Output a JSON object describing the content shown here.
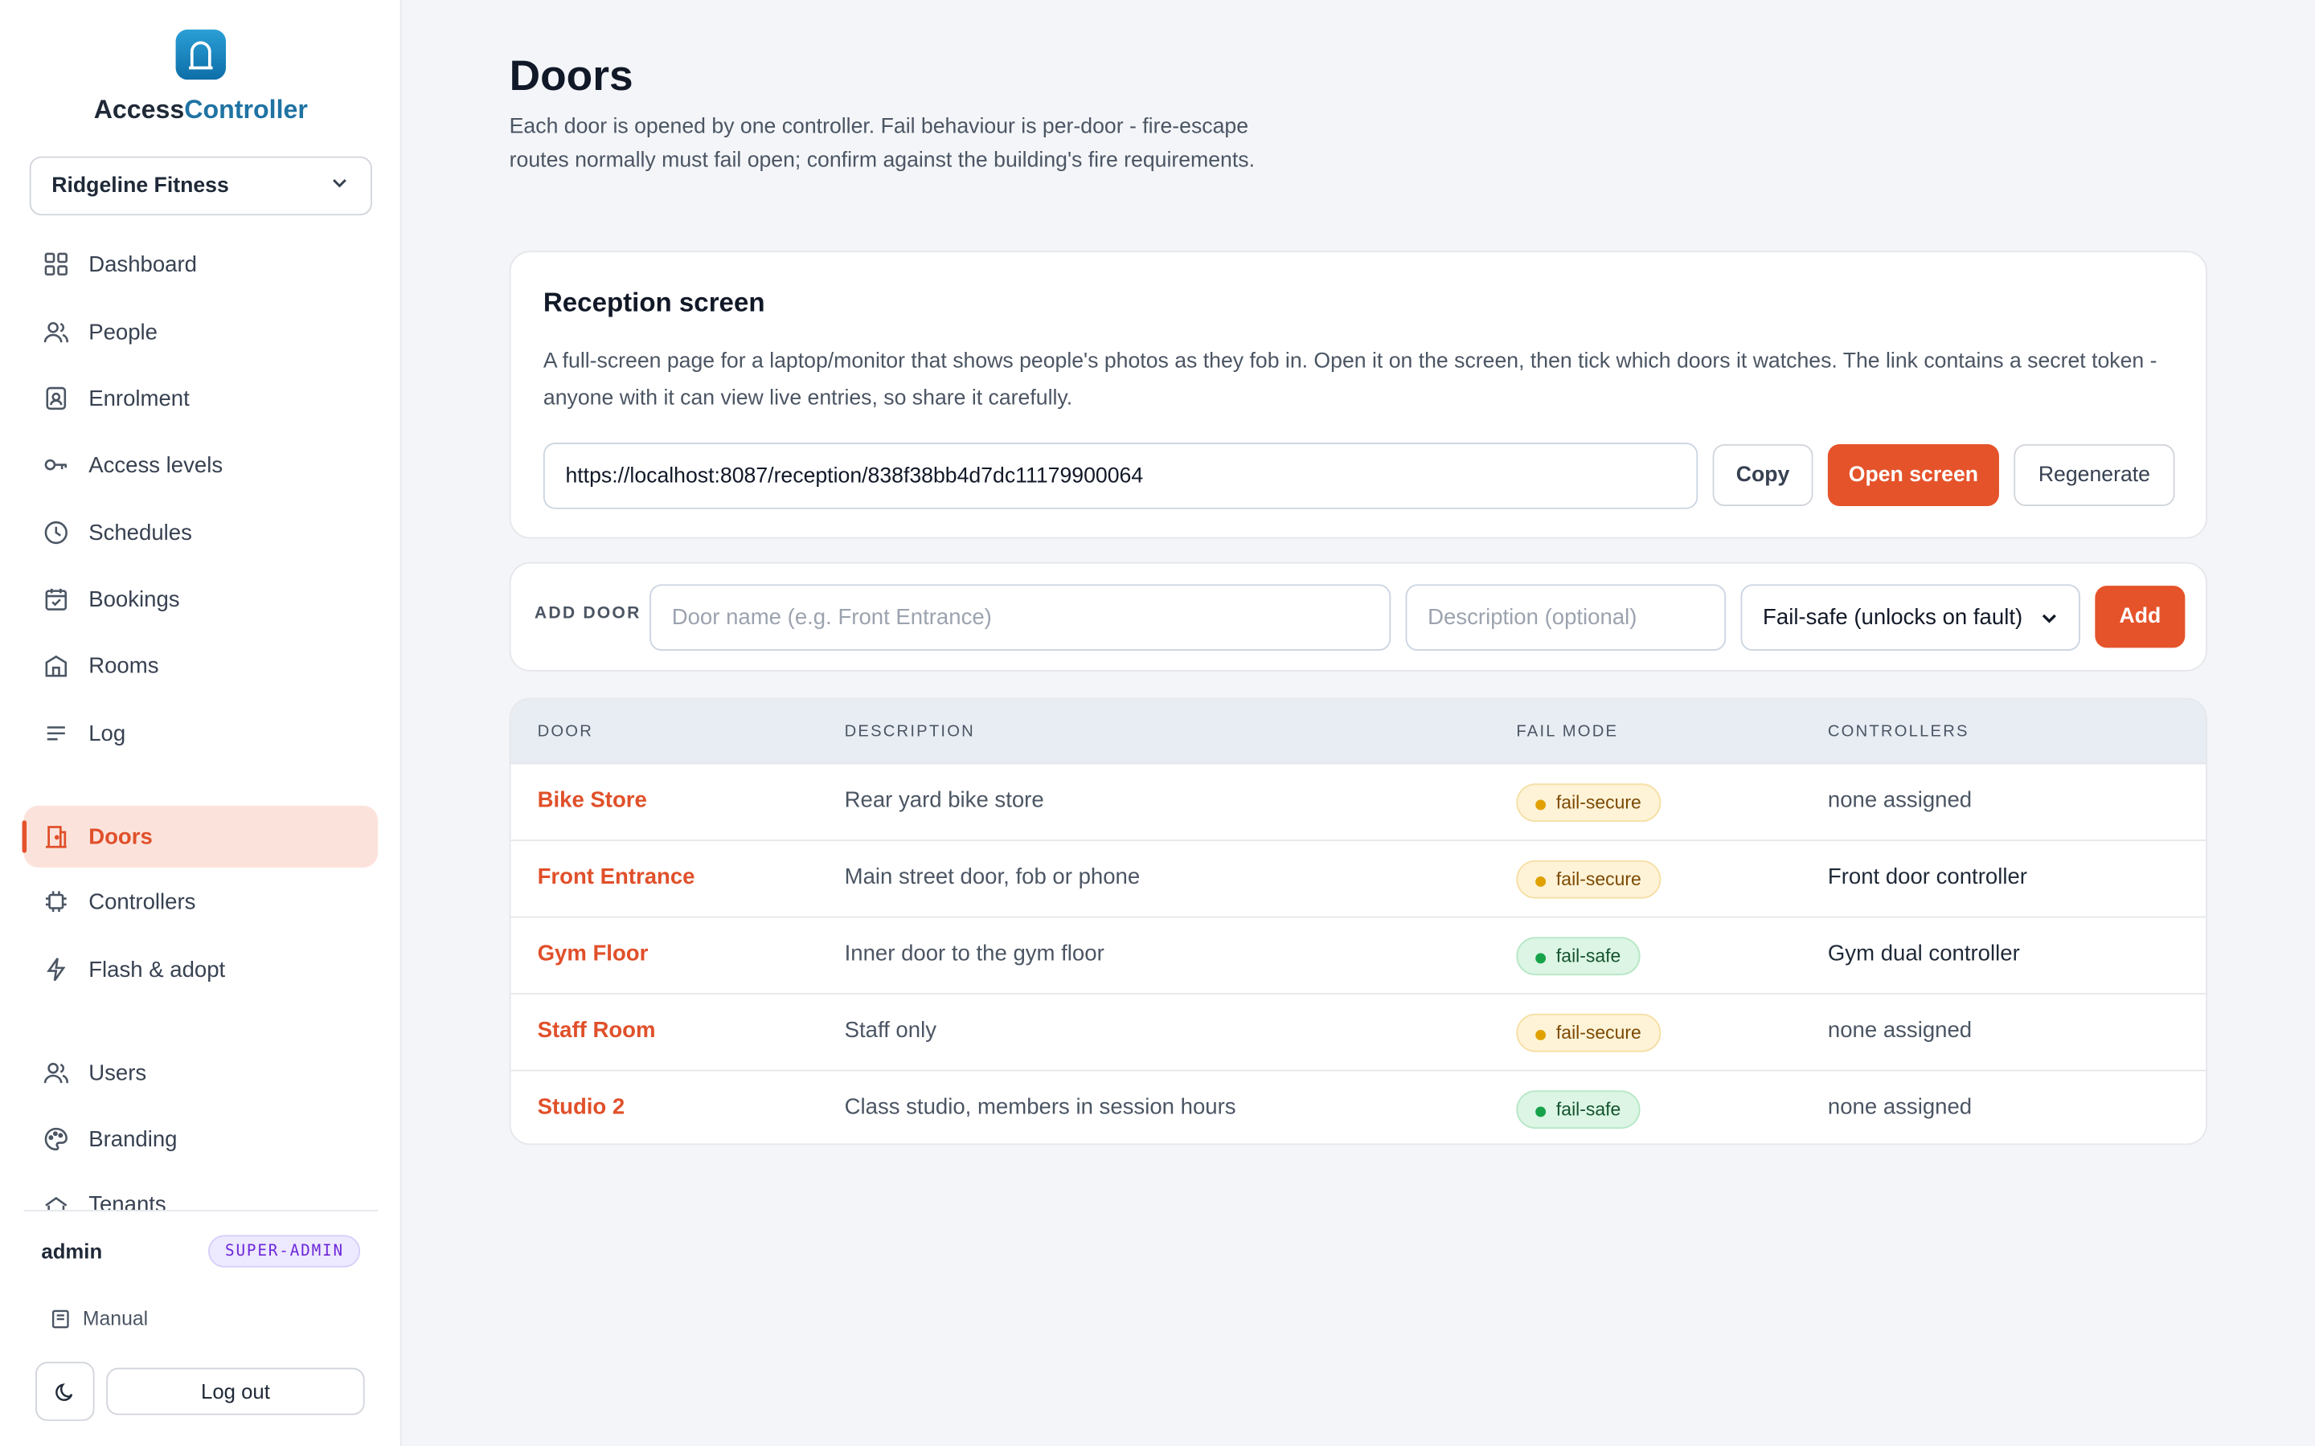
{
  "app": {
    "brand_prefix": "Access",
    "brand_suffix": "Controller",
    "tenant": "Ridgeline Fitness"
  },
  "sidebar": {
    "items": [
      {
        "label": "Dashboard",
        "icon": "grid-icon"
      },
      {
        "label": "People",
        "icon": "users-icon"
      },
      {
        "label": "Enrolment",
        "icon": "id-badge-icon"
      },
      {
        "label": "Access levels",
        "icon": "key-icon"
      },
      {
        "label": "Schedules",
        "icon": "clock-icon"
      },
      {
        "label": "Bookings",
        "icon": "calendar-icon"
      },
      {
        "label": "Rooms",
        "icon": "building-icon"
      },
      {
        "label": "Log",
        "icon": "list-icon"
      },
      {
        "label": "Doors",
        "icon": "door-icon",
        "active": true
      },
      {
        "label": "Controllers",
        "icon": "chip-icon"
      },
      {
        "label": "Flash & adopt",
        "icon": "lightning-icon"
      },
      {
        "label": "Users",
        "icon": "users-icon"
      },
      {
        "label": "Branding",
        "icon": "palette-icon"
      },
      {
        "label": "Tenants",
        "icon": "tenants-icon"
      }
    ],
    "user": "admin",
    "role": "SUPER-ADMIN",
    "manual": "Manual",
    "logout": "Log out"
  },
  "page": {
    "title": "Doors",
    "description": "Each door is opened by one controller. Fail behaviour is per-door - fire-escape routes normally must fail open; confirm against the building's fire requirements."
  },
  "reception": {
    "title": "Reception screen",
    "description": "A full-screen page for a laptop/monitor that shows people's photos as they fob in. Open it on the screen, then tick which doors it watches. The link contains a secret token - anyone with it can view live entries, so share it carefully.",
    "url": "https://localhost:8087/reception/838f38bb4d7dc11179900064",
    "copy": "Copy",
    "open": "Open screen",
    "regenerate": "Regenerate"
  },
  "add_door": {
    "label": "ADD DOOR",
    "name_placeholder": "Door name (e.g. Front Entrance)",
    "desc_placeholder": "Description (optional)",
    "fail_mode": "Fail-safe (unlocks on fault)",
    "add": "Add"
  },
  "table": {
    "headers": [
      "DOOR",
      "DESCRIPTION",
      "FAIL MODE",
      "CONTROLLERS"
    ],
    "rows": [
      {
        "door": "Bike Store",
        "description": "Rear yard bike store",
        "fail_mode": "fail-secure",
        "controllers": "none assigned"
      },
      {
        "door": "Front Entrance",
        "description": "Main street door, fob or phone",
        "fail_mode": "fail-secure",
        "controllers": "Front door controller"
      },
      {
        "door": "Gym Floor",
        "description": "Inner door to the gym floor",
        "fail_mode": "fail-safe",
        "controllers": "Gym dual controller"
      },
      {
        "door": "Staff Room",
        "description": "Staff only",
        "fail_mode": "fail-secure",
        "controllers": "none assigned"
      },
      {
        "door": "Studio 2",
        "description": "Class studio, members in session hours",
        "fail_mode": "fail-safe",
        "controllers": "none assigned"
      }
    ]
  },
  "colors": {
    "accent": "#e5532b",
    "brand": "#1f73a3",
    "fail_secure": "#e0a100",
    "fail_safe": "#16a34a"
  }
}
